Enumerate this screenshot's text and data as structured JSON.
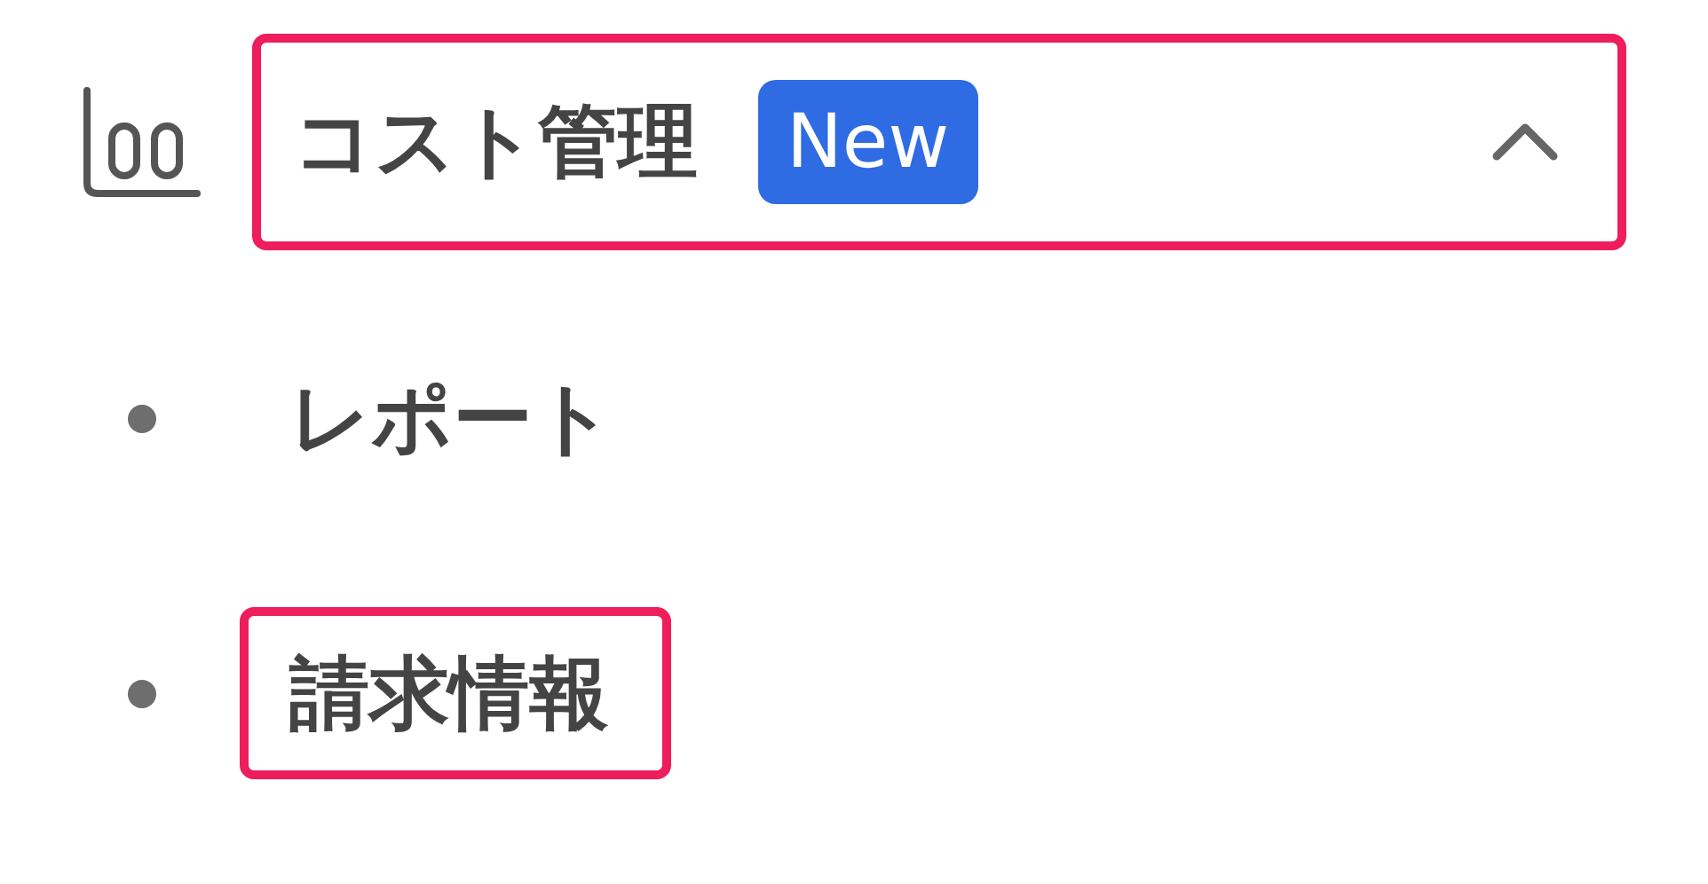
{
  "section": {
    "label": "コスト管理",
    "badge": "New",
    "expanded": true,
    "highlighted": true,
    "children": [
      {
        "label": "レポート",
        "highlighted": false
      },
      {
        "label": "請求情報",
        "highlighted": true
      }
    ]
  }
}
